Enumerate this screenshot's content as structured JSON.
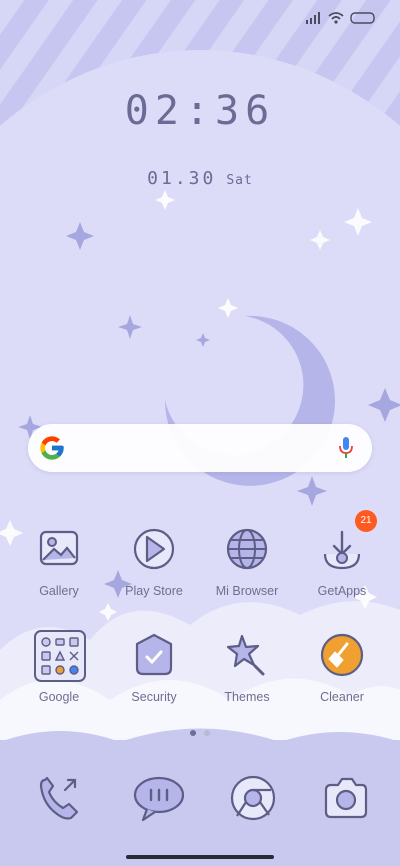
{
  "clock": {
    "time": "02:36",
    "date": "01.30",
    "weekday": "Sat"
  },
  "search": {},
  "apps_row1": [
    {
      "label": "Gallery",
      "icon": "gallery-icon"
    },
    {
      "label": "Play Store",
      "icon": "play-store-icon"
    },
    {
      "label": "Mi Browser",
      "icon": "browser-icon"
    },
    {
      "label": "GetApps",
      "icon": "getapps-icon",
      "badge": "21"
    }
  ],
  "apps_row2": [
    {
      "label": "Google",
      "icon": "google-folder-icon"
    },
    {
      "label": "Security",
      "icon": "security-icon"
    },
    {
      "label": "Themes",
      "icon": "themes-icon"
    },
    {
      "label": "Cleaner",
      "icon": "cleaner-icon"
    }
  ],
  "pager": {
    "pages": 2,
    "active": 0
  },
  "dock": [
    "phone-icon",
    "messages-icon",
    "chrome-icon",
    "camera-icon"
  ],
  "colors": {
    "wallpaper": "#c9c9f0",
    "moon": "#b5b5ea",
    "text": "#6b6b95",
    "badge": "#ff5a1f",
    "cleaner": "#f0a030"
  }
}
